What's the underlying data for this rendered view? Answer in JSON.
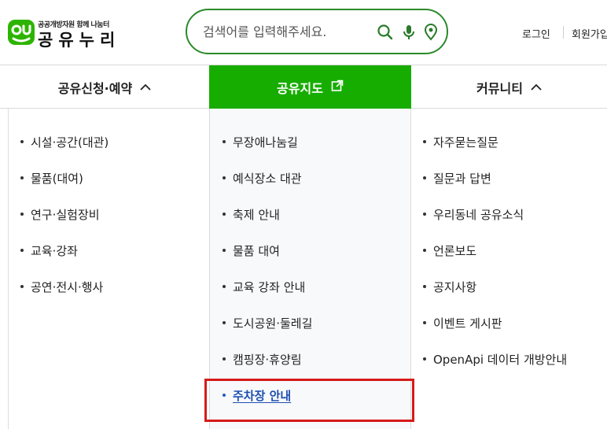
{
  "header": {
    "logo_sub": "공공개방자원 ·공유 누리 공공개방자원 · 공유누리 ·공유누리·공공개방자원",
    "logo_sub_text": "공공개방자원 공유누리",
    "logo_name": "공유누리",
    "logo_tagline": "공공개방자원 함께 나눔터",
    "search": {
      "placeholder": "검색어를 입력해주세요."
    },
    "utility": {
      "login": "로그인",
      "join": "회원가입"
    }
  },
  "gnb": [
    {
      "label": "공유신청·예약",
      "arrow": "^"
    },
    {
      "label": "공유지도",
      "icon": "external-link-icon"
    },
    {
      "label": "커뮤니티",
      "arrow": "^"
    }
  ],
  "submenu": {
    "col1": [
      "시설·공간(대관)",
      "물품(대여)",
      "연구·실험장비",
      "교육·강좌",
      "공연·전시·행사"
    ],
    "col2": [
      "무장애나눔길",
      "예식장소 대관",
      "축제 안내",
      "물품 대여",
      "교육 강좌 안내",
      "도시공원·둘레길",
      "캠핑장·휴양림",
      "주차장 안내"
    ],
    "col3": [
      "자주묻는질문",
      "질문과 답변",
      "우리동네 공유소식",
      "언론보도",
      "공지사항",
      "이벤트 게시판",
      "OpenApi 데이터 개방안내"
    ]
  },
  "colors": {
    "brand_green": "#17ad00",
    "active_link": "#1e4fb0",
    "highlight": "#d61a1a"
  }
}
